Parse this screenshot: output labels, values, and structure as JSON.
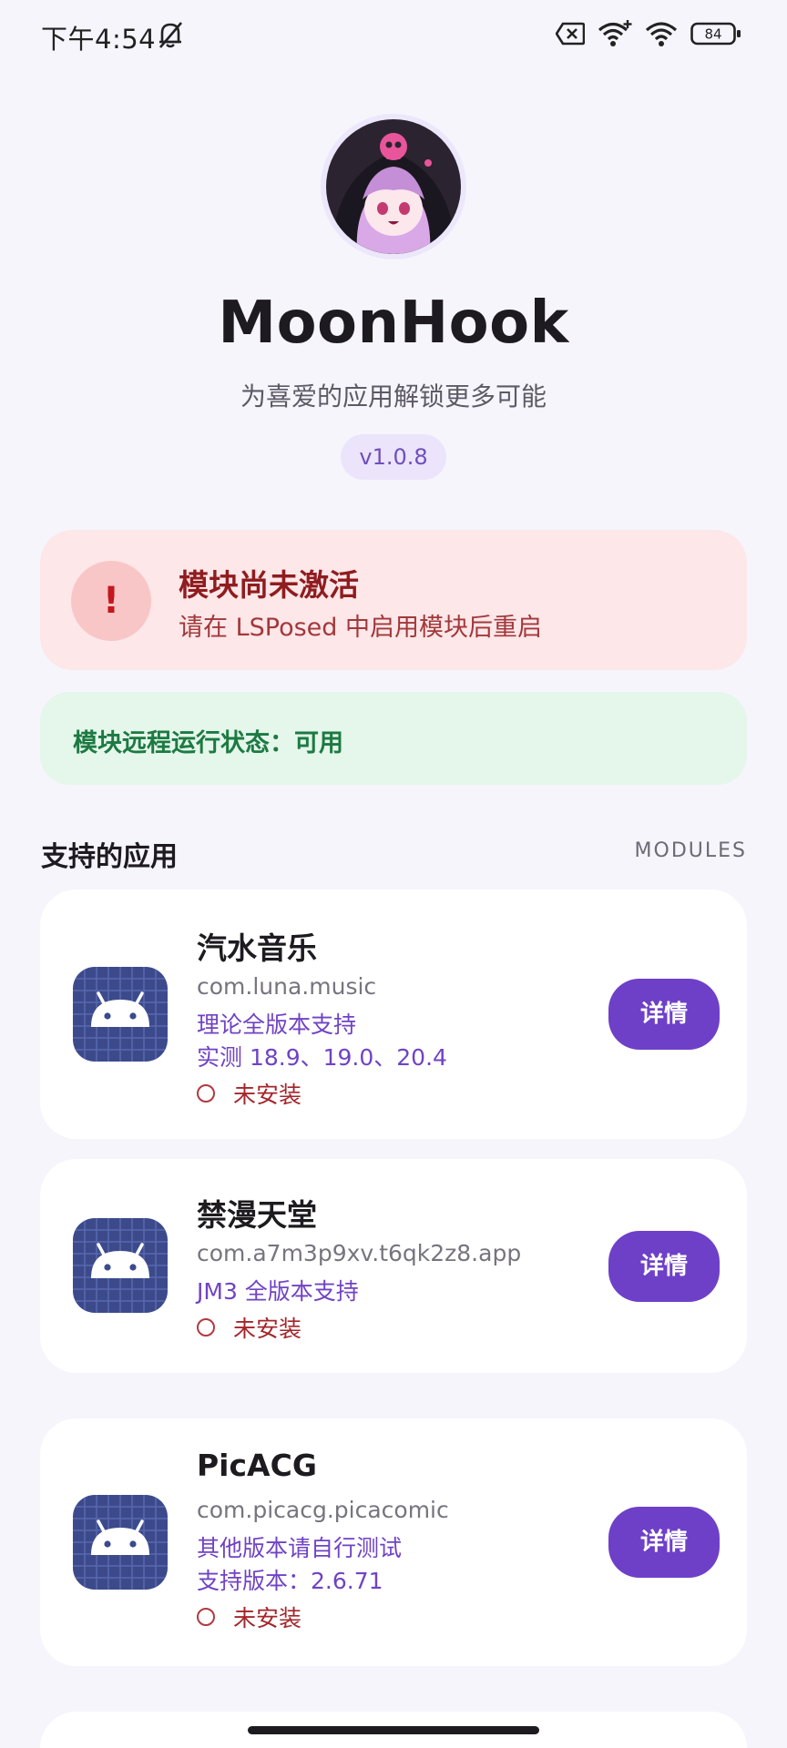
{
  "status_bar": {
    "time": "下午4:54",
    "battery": "84"
  },
  "header": {
    "title": "MoonHook",
    "subtitle": "为喜爱的应用解锁更多可能",
    "version": "v1.0.8"
  },
  "warning": {
    "title": "模块尚未激活",
    "message": "请在 LSPosed 中启用模块后重启",
    "icon_text": "!"
  },
  "remote_status": {
    "text": "模块远程运行状态：可用"
  },
  "section": {
    "title": "支持的应用",
    "tag": "MODULES"
  },
  "apps": [
    {
      "name": "汽水音乐",
      "package": "com.luna.music",
      "lines": [
        "理论全版本支持",
        "实测 18.9、19.0、20.4"
      ],
      "state": "未安装",
      "button": "详情"
    },
    {
      "name": "禁漫天堂",
      "package": "com.a7m3p9xv.t6qk2z8.app",
      "lines": [
        "JM3 全版本支持"
      ],
      "state": "未安装",
      "button": "详情"
    },
    {
      "name": "PicACG",
      "package": "com.picacg.picacomic",
      "lines": [
        "其他版本请自行测试",
        "支持版本：2.6.71"
      ],
      "state": "未安装",
      "button": "详情"
    }
  ],
  "colors": {
    "accent": "#6e40c8",
    "warning_bg": "#fde7e8",
    "success_bg": "#e5f6ea",
    "app_icon_bg": "#3c4a8c"
  }
}
